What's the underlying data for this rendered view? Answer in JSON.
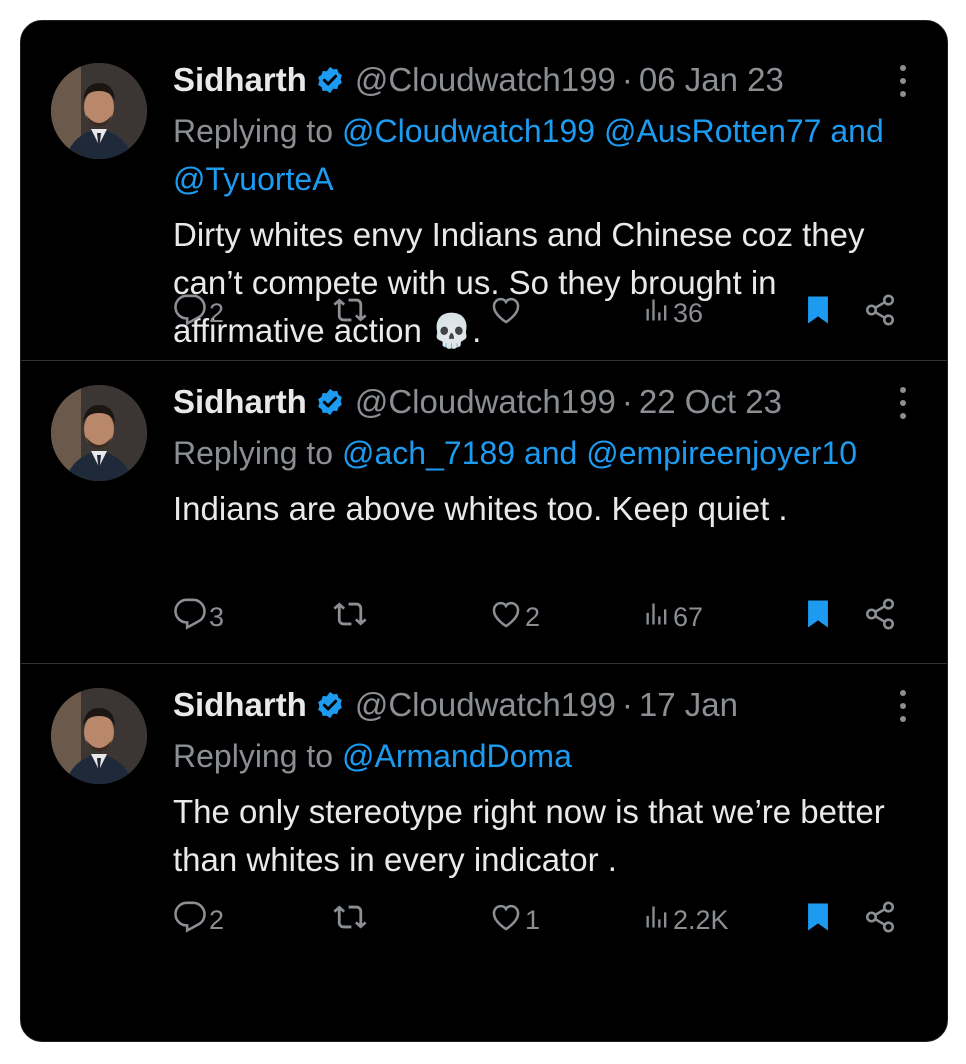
{
  "colors": {
    "background": "#000000",
    "text": "#e7e9ea",
    "muted": "#8b8f94",
    "link": "#1d9bf0",
    "divider": "#2f3336"
  },
  "tweets": [
    {
      "name": "Sidharth",
      "handle": "@Cloudwatch199",
      "separator": "·",
      "date": "06 Jan 23",
      "replying_prefix": "Replying to",
      "replying_links": [
        "@Cloudwatch199",
        "@AusRotten77"
      ],
      "replying_and": "and",
      "replying_last": "@TyuorteA",
      "text": "Dirty whites envy Indians and Chinese coz they can’t compete with us. So they brought in affirmative action 💀.",
      "replies": "2",
      "retweets": "",
      "likes": "",
      "views": "36",
      "icons": [
        "verified-icon",
        "more-icon",
        "reply-icon",
        "retweet-icon",
        "like-icon",
        "views-icon",
        "bookmark-icon",
        "share-icon"
      ]
    },
    {
      "name": "Sidharth",
      "handle": "@Cloudwatch199",
      "separator": "·",
      "date": "22 Oct 23",
      "replying_prefix": "Replying to",
      "replying_links": [
        "@ach_7189"
      ],
      "replying_and": "and",
      "replying_last": "@empireenjoyer10",
      "text": "Indians are above whites too. Keep quiet .",
      "replies": "3",
      "retweets": "",
      "likes": "2",
      "views": "67",
      "icons": [
        "verified-icon",
        "more-icon",
        "reply-icon",
        "retweet-icon",
        "like-icon",
        "views-icon",
        "bookmark-icon",
        "share-icon"
      ]
    },
    {
      "name": "Sidharth",
      "handle": "@Cloudwatch199",
      "separator": "·",
      "date": "17 Jan",
      "replying_prefix": "Replying to",
      "replying_links": [
        "@ArmandDoma"
      ],
      "replying_and": "",
      "replying_last": "",
      "text": "The only stereotype right now is that we’re better than whites in every indicator .",
      "replies": "2",
      "retweets": "",
      "likes": "1",
      "views": "2.2K",
      "icons": [
        "verified-icon",
        "more-icon",
        "reply-icon",
        "retweet-icon",
        "like-icon",
        "views-icon",
        "bookmark-icon",
        "share-icon"
      ]
    }
  ]
}
